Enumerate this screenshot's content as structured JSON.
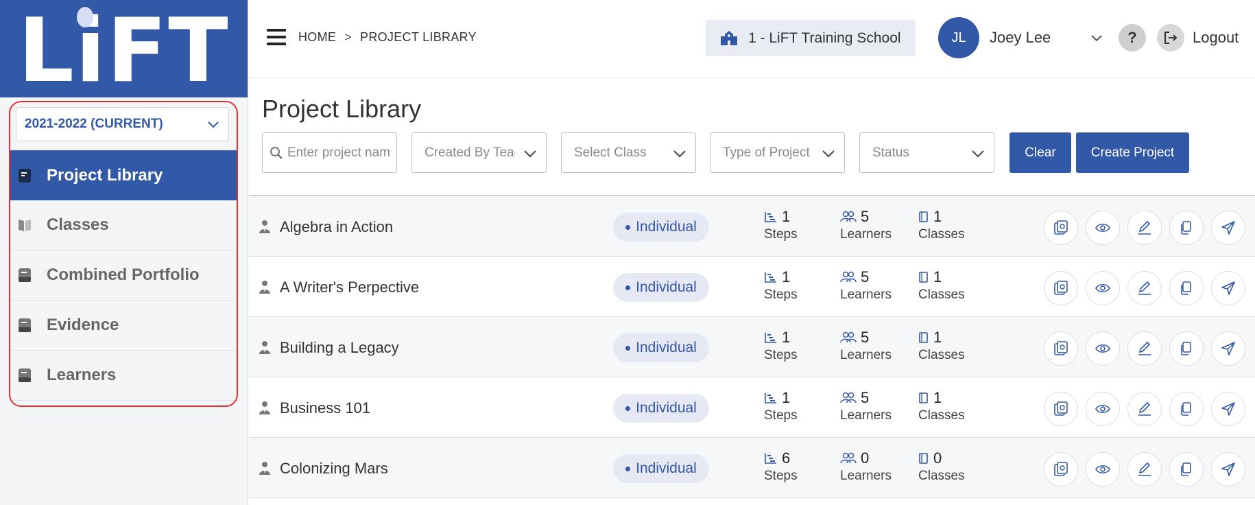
{
  "sidebar": {
    "logo_text": "LiFT",
    "year_select": "2021-2022 (CURRENT)",
    "items": [
      {
        "label": "Project Library",
        "active": true
      },
      {
        "label": "Classes",
        "active": false
      },
      {
        "label": "Combined Portfolio",
        "active": false
      },
      {
        "label": "Evidence",
        "active": false
      },
      {
        "label": "Learners",
        "active": false
      }
    ]
  },
  "header": {
    "breadcrumb": {
      "home": "HOME",
      "separator": ">",
      "current": "PROJECT LIBRARY"
    },
    "school": "1 - LiFT Training School",
    "user_initials": "JL",
    "user_name": "Joey Lee",
    "help_label": "?",
    "logout_label": "Logout"
  },
  "main": {
    "title": "Project Library",
    "search_placeholder": "Enter project name",
    "filters": {
      "created_by": "Created By Teacher",
      "select_class": "Select Class",
      "type_of_project": "Type of Project",
      "status": "Status"
    },
    "clear_label": "Clear",
    "create_label": "Create Project",
    "stat_labels": {
      "steps": "Steps",
      "learners": "Learners",
      "classes": "Classes"
    },
    "projects": [
      {
        "name": "Algebra in Action",
        "type": "Individual",
        "steps": "1",
        "learners": "5",
        "classes": "1"
      },
      {
        "name": "A Writer's Perpective",
        "type": "Individual",
        "steps": "1",
        "learners": "5",
        "classes": "1"
      },
      {
        "name": "Building a Legacy",
        "type": "Individual",
        "steps": "1",
        "learners": "5",
        "classes": "1"
      },
      {
        "name": "Business 101",
        "type": "Individual",
        "steps": "1",
        "learners": "5",
        "classes": "1"
      },
      {
        "name": "Colonizing Mars",
        "type": "Individual",
        "steps": "6",
        "learners": "0",
        "classes": "0"
      }
    ]
  },
  "colors": {
    "brand": "#3258a8",
    "highlight": "#e2312f",
    "badge_bg": "#e6e8f3"
  }
}
